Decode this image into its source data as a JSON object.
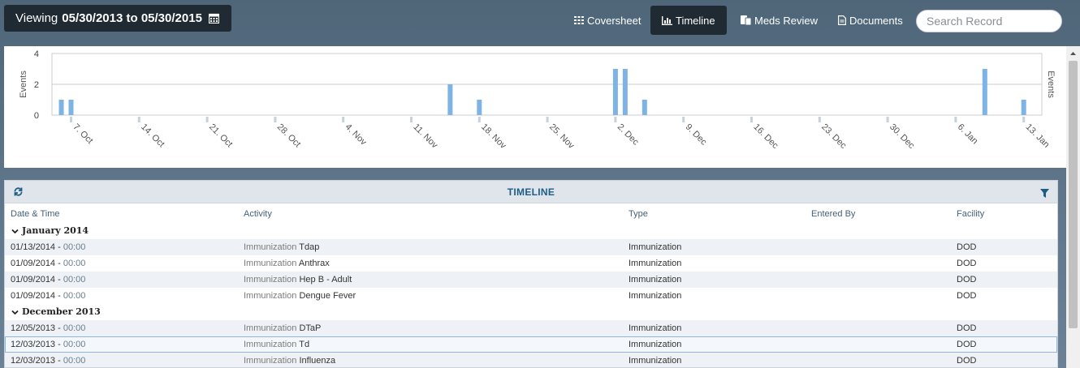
{
  "header": {
    "viewing_prefix": "Viewing",
    "viewing_range": "05/30/2013 to 05/30/2015",
    "nav": [
      {
        "label": "Coversheet",
        "icon": "grid-icon"
      },
      {
        "label": "Timeline",
        "icon": "bar-chart-icon",
        "active": true
      },
      {
        "label": "Meds Review",
        "icon": "meds-icon"
      },
      {
        "label": "Documents",
        "icon": "document-icon"
      }
    ],
    "search_placeholder": "Search Record"
  },
  "colors": {
    "bar": "#7eb3e6",
    "header_dark": "#1f2a33",
    "title_blue": "#1d5e86"
  },
  "chart_data": {
    "type": "bar",
    "ylabel": "Events",
    "ylabel_right": "Events",
    "yticks": [
      0,
      2,
      4
    ],
    "ylim": [
      0,
      4
    ],
    "xticks": [
      "7. Oct",
      "14. Oct",
      "21. Oct",
      "28. Oct",
      "4. Nov",
      "11. Nov",
      "18. Nov",
      "25. Nov",
      "2. Dec",
      "9. Dec",
      "16. Dec",
      "23. Dec",
      "30. Dec",
      "6. Jan",
      "13. Jan"
    ],
    "first_tick": "2013-10-07",
    "x": [
      "2013-10-06",
      "2013-10-07",
      "2013-11-15",
      "2013-11-18",
      "2013-12-02",
      "2013-12-03",
      "2013-12-05",
      "2014-01-09",
      "2014-01-13"
    ],
    "values": [
      1,
      1,
      2,
      1,
      3,
      3,
      1,
      3,
      1
    ],
    "grid": true
  },
  "table": {
    "title": "TIMELINE",
    "columns": [
      "Date & Time",
      "Activity",
      "Type",
      "Entered By",
      "Facility"
    ],
    "groups": [
      {
        "label": "January 2014",
        "rows": [
          {
            "date": "01/13/2014",
            "time": "00:00",
            "activity_type": "Immunization",
            "activity": "Tdap",
            "type": "Immunization",
            "entered_by": "",
            "facility": "DOD"
          },
          {
            "date": "01/09/2014",
            "time": "00:00",
            "activity_type": "Immunization",
            "activity": "Anthrax",
            "type": "Immunization",
            "entered_by": "",
            "facility": "DOD"
          },
          {
            "date": "01/09/2014",
            "time": "00:00",
            "activity_type": "Immunization",
            "activity": "Hep B - Adult",
            "type": "Immunization",
            "entered_by": "",
            "facility": "DOD"
          },
          {
            "date": "01/09/2014",
            "time": "00:00",
            "activity_type": "Immunization",
            "activity": "Dengue Fever",
            "type": "Immunization",
            "entered_by": "",
            "facility": "DOD"
          }
        ]
      },
      {
        "label": "December 2013",
        "rows": [
          {
            "date": "12/05/2013",
            "time": "00:00",
            "activity_type": "Immunization",
            "activity": "DTaP",
            "type": "Immunization",
            "entered_by": "",
            "facility": "DOD"
          },
          {
            "date": "12/03/2013",
            "time": "00:00",
            "activity_type": "Immunization",
            "activity": "Td",
            "type": "Immunization",
            "entered_by": "",
            "facility": "DOD",
            "selected": true
          },
          {
            "date": "12/03/2013",
            "time": "00:00",
            "activity_type": "Immunization",
            "activity": "Influenza",
            "type": "Immunization",
            "entered_by": "",
            "facility": "DOD"
          }
        ]
      }
    ]
  }
}
